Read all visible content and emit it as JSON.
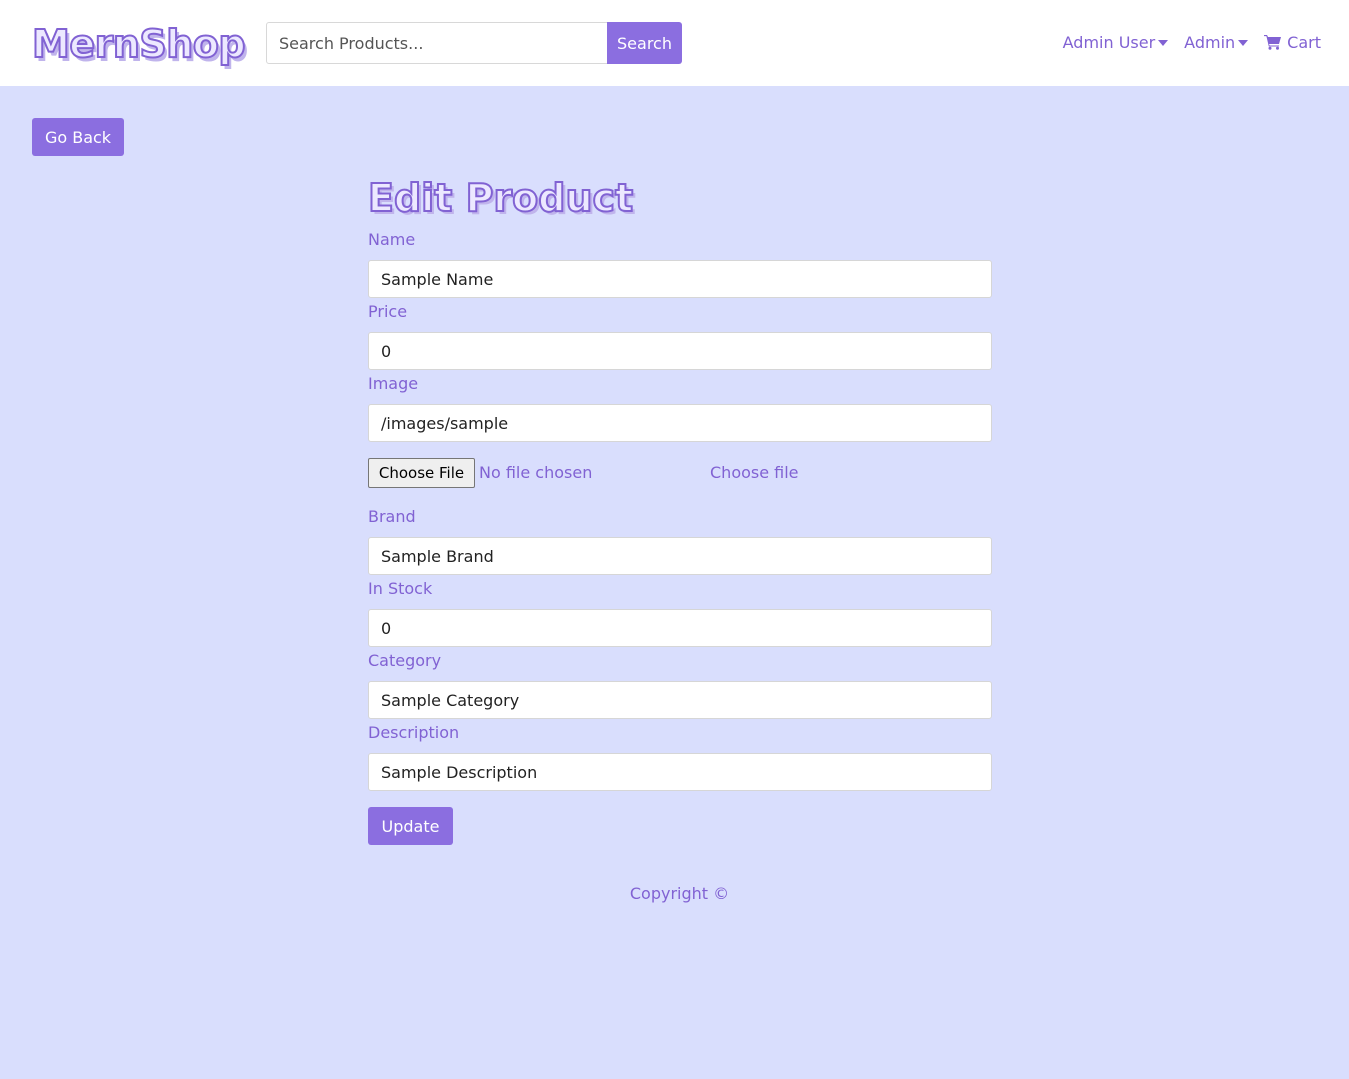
{
  "navbar": {
    "brand": "MernShop",
    "search": {
      "placeholder": "Search Products...",
      "value": "",
      "button_label": "Search"
    },
    "user_menu_label": "Admin User",
    "admin_menu_label": "Admin",
    "cart_label": "Cart",
    "cart_icon": "shopping-cart-icon"
  },
  "actions": {
    "go_back_label": "Go Back"
  },
  "form": {
    "title": "Edit Product",
    "name_label": "Name",
    "name_value": "Sample Name",
    "price_label": "Price",
    "price_value": "0",
    "image_label": "Image",
    "image_value": "/images/sample",
    "file_button_label": "Choose File",
    "file_status": "No file chosen",
    "file_label": "Choose file",
    "brand_label": "Brand",
    "brand_value": "Sample Brand",
    "stock_label": "In Stock",
    "stock_value": "0",
    "category_label": "Category",
    "category_value": "Sample Category",
    "description_label": "Description",
    "description_value": "Sample Description",
    "submit_label": "Update"
  },
  "footer": {
    "copyright": "Copyright ©"
  },
  "colors": {
    "accent": "#8b6ee0",
    "text": "#8162d3",
    "background": "#d9defd",
    "navbar": "#ffffff"
  }
}
